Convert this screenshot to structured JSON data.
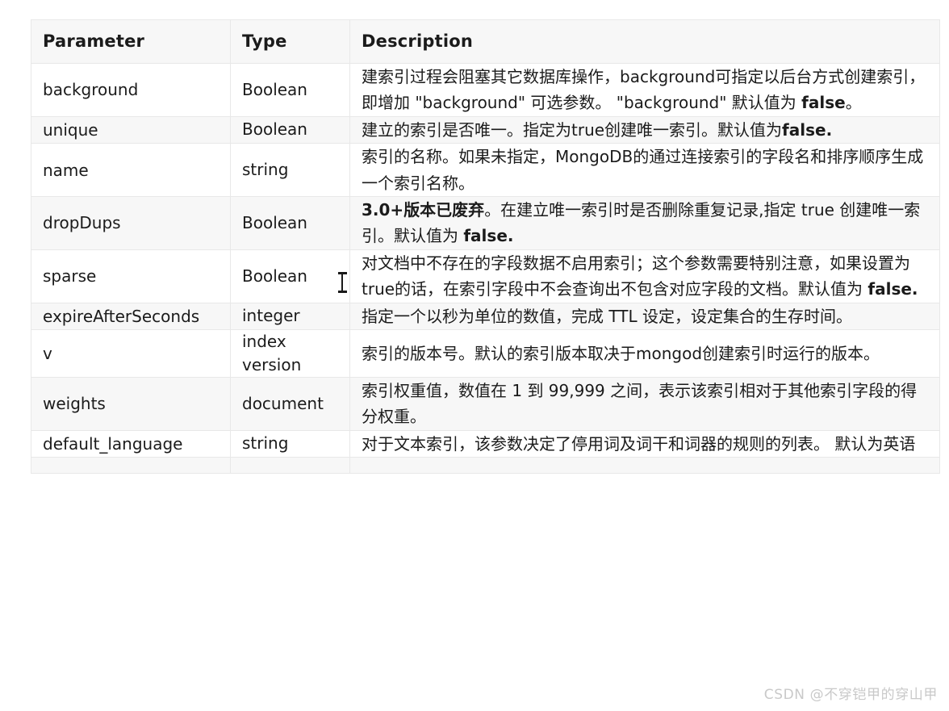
{
  "table": {
    "name": "mongodb-createindex-options",
    "columns": [
      {
        "key": "parameter",
        "label": "Parameter"
      },
      {
        "key": "type",
        "label": "Type"
      },
      {
        "key": "description",
        "label": "Description"
      }
    ],
    "rows": [
      {
        "parameter": "background",
        "type": "Boolean",
        "description_parts": [
          {
            "text": "建索引过程会阻塞其它数据库操作，background可指定以后台方式创建索引，即增加 \"background\" 可选参数。 \"background\" 默认值为 ",
            "bold": false
          },
          {
            "text": "false",
            "bold": true
          },
          {
            "text": "。",
            "bold": false
          }
        ],
        "shade": "white"
      },
      {
        "parameter": "unique",
        "type": "Boolean",
        "description_parts": [
          {
            "text": "建立的索引是否唯一。指定为true创建唯一索引。默认值为",
            "bold": false
          },
          {
            "text": "false.",
            "bold": true
          }
        ],
        "shade": "gray"
      },
      {
        "parameter": "name",
        "type": "string",
        "description_parts": [
          {
            "text": "索引的名称。如果未指定，MongoDB的通过连接索引的字段名和排序顺序生成一个索引名称。",
            "bold": false
          }
        ],
        "shade": "white"
      },
      {
        "parameter": "dropDups",
        "type": "Boolean",
        "description_parts": [
          {
            "text": "3.0+版本已废弃",
            "bold": true
          },
          {
            "text": "。在建立唯一索引时是否删除重复记录,指定 true 创建唯一索引。默认值为 ",
            "bold": false
          },
          {
            "text": "false.",
            "bold": true
          }
        ],
        "shade": "gray"
      },
      {
        "parameter": "sparse",
        "type": "Boolean",
        "description_parts": [
          {
            "text": "对文档中不存在的字段数据不启用索引；这个参数需要特别注意，如果设置为true的话，在索引字段中不会查询出不包含对应字段的文档。默认值为 ",
            "bold": false
          },
          {
            "text": "false.",
            "bold": true
          }
        ],
        "shade": "white"
      },
      {
        "parameter": "expireAfterSeconds",
        "type": "integer",
        "description_parts": [
          {
            "text": "指定一个以秒为单位的数值，完成 TTL 设定，设定集合的生存时间。",
            "bold": false
          }
        ],
        "shade": "gray"
      },
      {
        "parameter": "v",
        "type": "index version",
        "description_parts": [
          {
            "text": "索引的版本号。默认的索引版本取决于mongod创建索引时运行的版本。",
            "bold": false
          }
        ],
        "shade": "white"
      },
      {
        "parameter": "weights",
        "type": "document",
        "description_parts": [
          {
            "text": "索引权重值，数值在 1 到 99,999 之间，表示该索引相对于其他索引字段的得分权重。",
            "bold": false
          }
        ],
        "shade": "gray"
      },
      {
        "parameter": "default_language",
        "type": "string",
        "description_parts": [
          {
            "text": "对于文本索引，该参数决定了停用词及词干和词器的规则的列表。 默认为英语",
            "bold": false
          }
        ],
        "shade": "white"
      }
    ]
  },
  "watermark": {
    "text": "CSDN @不穿铠甲的穿山甲"
  },
  "cursor": {
    "kind": "text-caret"
  },
  "colors": {
    "page_background": "#ffffff",
    "row_shade": "#f7f7f7",
    "border": "#e8e8e8",
    "text": "#1a1a1a",
    "watermark": "#c9c9c9"
  }
}
